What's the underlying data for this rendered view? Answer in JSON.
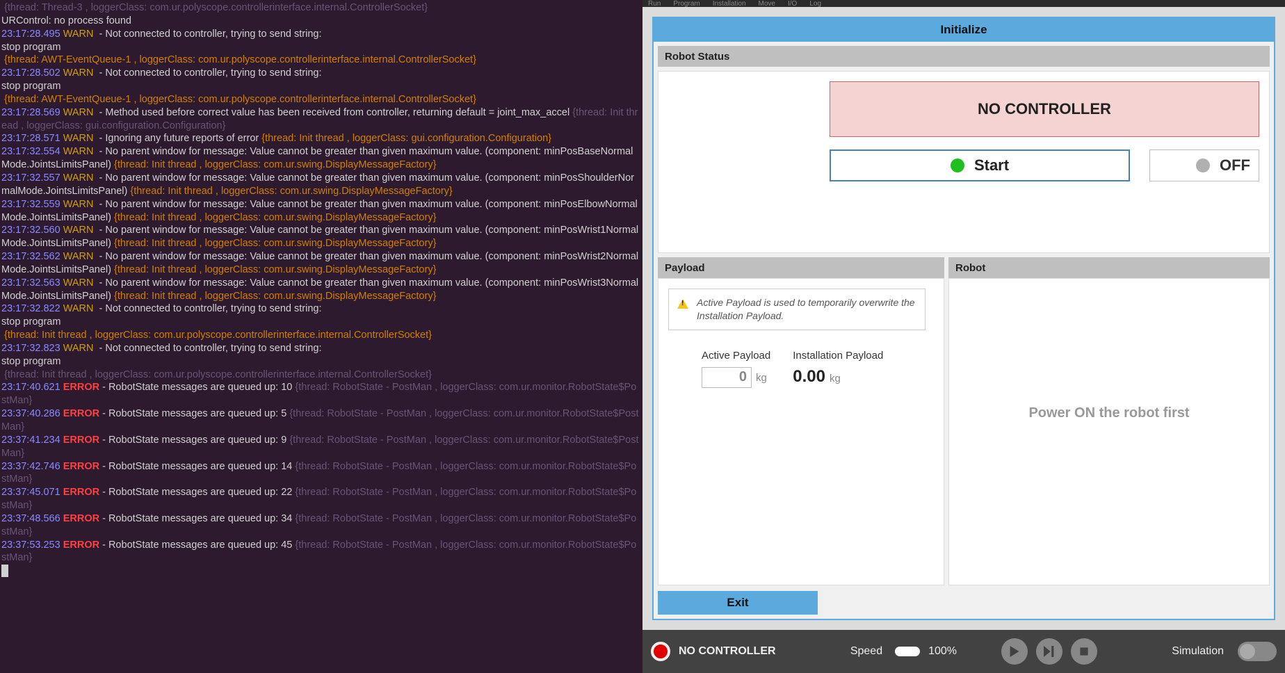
{
  "terminal": {
    "lines": [
      {
        "segments": [
          {
            "text": " {thread: Thread-3 , loggerClass: com.ur.polyscope.controllerinterface.internal.ControllerSocket}",
            "cls": "meta"
          }
        ]
      },
      {
        "segments": [
          {
            "text": "URControl: no process found",
            "cls": "msg"
          }
        ]
      },
      {
        "segments": [
          {
            "text": "23:17:28.495 ",
            "cls": "ts"
          },
          {
            "text": "WARN ",
            "cls": "warn"
          },
          {
            "text": " - Not connected to controller, trying to send string:",
            "cls": "msg"
          }
        ]
      },
      {
        "segments": [
          {
            "text": "stop program",
            "cls": "msg"
          }
        ]
      },
      {
        "segments": [
          {
            "text": " {thread: AWT-EventQueue-1 , loggerClass: com.ur.polyscope.controllerinterface.internal.ControllerSocket}",
            "cls": "ctx"
          }
        ]
      },
      {
        "segments": [
          {
            "text": "23:17:28.502 ",
            "cls": "ts"
          },
          {
            "text": "WARN ",
            "cls": "warn"
          },
          {
            "text": " - Not connected to controller, trying to send string:",
            "cls": "msg"
          }
        ]
      },
      {
        "segments": [
          {
            "text": "stop program",
            "cls": "msg"
          }
        ]
      },
      {
        "segments": [
          {
            "text": " {thread: AWT-EventQueue-1 , loggerClass: com.ur.polyscope.controllerinterface.internal.ControllerSocket}",
            "cls": "ctx"
          }
        ]
      },
      {
        "segments": [
          {
            "text": "23:17:28.569 ",
            "cls": "ts"
          },
          {
            "text": "WARN ",
            "cls": "warn"
          },
          {
            "text": " - Method used before correct value has been received from controller, returning default = joint_max_accel ",
            "cls": "msg"
          },
          {
            "text": "{thread: Init thread , loggerClass: gui.configuration.Configuration}",
            "cls": "meta"
          }
        ]
      },
      {
        "segments": [
          {
            "text": "23:17:28.571 ",
            "cls": "ts"
          },
          {
            "text": "WARN ",
            "cls": "warn"
          },
          {
            "text": " - Ignoring any future reports of error ",
            "cls": "msg"
          },
          {
            "text": "{thread: Init thread , loggerClass: gui.configuration.Configuration}",
            "cls": "ctx"
          }
        ]
      },
      {
        "segments": [
          {
            "text": "23:17:32.554 ",
            "cls": "ts"
          },
          {
            "text": "WARN ",
            "cls": "warn"
          },
          {
            "text": " - No parent window for message: Value cannot be greater than given maximum value. (component: minPosBaseNormalMode.JointsLimitsPanel) ",
            "cls": "msg"
          },
          {
            "text": "{thread: Init thread , loggerClass: com.ur.swing.DisplayMessageFactory}",
            "cls": "ctx"
          }
        ]
      },
      {
        "segments": [
          {
            "text": "23:17:32.557 ",
            "cls": "ts"
          },
          {
            "text": "WARN ",
            "cls": "warn"
          },
          {
            "text": " - No parent window for message: Value cannot be greater than given maximum value. (component: minPosShoulderNormalMode.JointsLimitsPanel) ",
            "cls": "msg"
          },
          {
            "text": "{thread: Init thread , loggerClass: com.ur.swing.DisplayMessageFactory}",
            "cls": "ctx"
          }
        ]
      },
      {
        "segments": [
          {
            "text": "23:17:32.559 ",
            "cls": "ts"
          },
          {
            "text": "WARN ",
            "cls": "warn"
          },
          {
            "text": " - No parent window for message: Value cannot be greater than given maximum value. (component: minPosElbowNormalMode.JointsLimitsPanel) ",
            "cls": "msg"
          },
          {
            "text": "{thread: Init thread , loggerClass: com.ur.swing.DisplayMessageFactory}",
            "cls": "ctx"
          }
        ]
      },
      {
        "segments": [
          {
            "text": "23:17:32.560 ",
            "cls": "ts"
          },
          {
            "text": "WARN ",
            "cls": "warn"
          },
          {
            "text": " - No parent window for message: Value cannot be greater than given maximum value. (component: minPosWrist1NormalMode.JointsLimitsPanel) ",
            "cls": "msg"
          },
          {
            "text": "{thread: Init thread , loggerClass: com.ur.swing.DisplayMessageFactory}",
            "cls": "ctx"
          }
        ]
      },
      {
        "segments": [
          {
            "text": "23:17:32.562 ",
            "cls": "ts"
          },
          {
            "text": "WARN ",
            "cls": "warn"
          },
          {
            "text": " - No parent window for message: Value cannot be greater than given maximum value. (component: minPosWrist2NormalMode.JointsLimitsPanel) ",
            "cls": "msg"
          },
          {
            "text": "{thread: Init thread , loggerClass: com.ur.swing.DisplayMessageFactory}",
            "cls": "ctx"
          }
        ]
      },
      {
        "segments": [
          {
            "text": "23:17:32.563 ",
            "cls": "ts"
          },
          {
            "text": "WARN ",
            "cls": "warn"
          },
          {
            "text": " - No parent window for message: Value cannot be greater than given maximum value. (component: minPosWrist3NormalMode.JointsLimitsPanel) ",
            "cls": "msg"
          },
          {
            "text": "{thread: Init thread , loggerClass: com.ur.swing.DisplayMessageFactory}",
            "cls": "ctx"
          }
        ]
      },
      {
        "segments": [
          {
            "text": "23:17:32.822 ",
            "cls": "ts"
          },
          {
            "text": "WARN ",
            "cls": "warn"
          },
          {
            "text": " - Not connected to controller, trying to send string:",
            "cls": "msg"
          }
        ]
      },
      {
        "segments": [
          {
            "text": "stop program",
            "cls": "msg"
          }
        ]
      },
      {
        "segments": [
          {
            "text": " {thread: Init thread , loggerClass: com.ur.polyscope.controllerinterface.internal.ControllerSocket}",
            "cls": "ctx"
          }
        ]
      },
      {
        "segments": [
          {
            "text": "23:17:32.823 ",
            "cls": "ts"
          },
          {
            "text": "WARN ",
            "cls": "warn"
          },
          {
            "text": " - Not connected to controller, trying to send string:",
            "cls": "msg"
          }
        ]
      },
      {
        "segments": [
          {
            "text": "stop program",
            "cls": "msg"
          }
        ]
      },
      {
        "segments": [
          {
            "text": " {thread: Init thread , loggerClass: com.ur.polyscope.controllerinterface.internal.ControllerSocket}",
            "cls": "meta"
          }
        ]
      },
      {
        "segments": [
          {
            "text": "23:17:40.621 ",
            "cls": "ts"
          },
          {
            "text": "ERROR",
            "cls": "err"
          },
          {
            "text": " - RobotState messages are queued up: 10 ",
            "cls": "msg"
          },
          {
            "text": "{thread: RobotState - PostMan , loggerClass: com.ur.monitor.RobotState$PostMan}",
            "cls": "meta"
          }
        ]
      },
      {
        "segments": [
          {
            "text": "23:37:40.286 ",
            "cls": "ts"
          },
          {
            "text": "ERROR",
            "cls": "err"
          },
          {
            "text": " - RobotState messages are queued up: 5 ",
            "cls": "msg"
          },
          {
            "text": "{thread: RobotState - PostMan , loggerClass: com.ur.monitor.RobotState$PostMan}",
            "cls": "meta"
          }
        ]
      },
      {
        "segments": [
          {
            "text": "23:37:41.234 ",
            "cls": "ts"
          },
          {
            "text": "ERROR",
            "cls": "err"
          },
          {
            "text": " - RobotState messages are queued up: 9 ",
            "cls": "msg"
          },
          {
            "text": "{thread: RobotState - PostMan , loggerClass: com.ur.monitor.RobotState$PostMan}",
            "cls": "meta"
          }
        ]
      },
      {
        "segments": [
          {
            "text": "23:37:42.746 ",
            "cls": "ts"
          },
          {
            "text": "ERROR",
            "cls": "err"
          },
          {
            "text": " - RobotState messages are queued up: 14 ",
            "cls": "msg"
          },
          {
            "text": "{thread: RobotState - PostMan , loggerClass: com.ur.monitor.RobotState$PostMan}",
            "cls": "meta"
          }
        ]
      },
      {
        "segments": [
          {
            "text": "23:37:45.071 ",
            "cls": "ts"
          },
          {
            "text": "ERROR",
            "cls": "err"
          },
          {
            "text": " - RobotState messages are queued up: 22 ",
            "cls": "msg"
          },
          {
            "text": "{thread: RobotState - PostMan , loggerClass: com.ur.monitor.RobotState$PostMan}",
            "cls": "meta"
          }
        ]
      },
      {
        "segments": [
          {
            "text": "23:37:48.566 ",
            "cls": "ts"
          },
          {
            "text": "ERROR",
            "cls": "err"
          },
          {
            "text": " - RobotState messages are queued up: 34 ",
            "cls": "msg"
          },
          {
            "text": "{thread: RobotState - PostMan , loggerClass: com.ur.monitor.RobotState$PostMan}",
            "cls": "meta"
          }
        ]
      },
      {
        "segments": [
          {
            "text": "23:37:53.253 ",
            "cls": "ts"
          },
          {
            "text": "ERROR",
            "cls": "err"
          },
          {
            "text": " - RobotState messages are queued up: 45 ",
            "cls": "msg"
          },
          {
            "text": "{thread: RobotState - PostMan , loggerClass: com.ur.monitor.RobotState$PostMan}",
            "cls": "meta"
          }
        ]
      }
    ]
  },
  "menu": {
    "items": [
      "Run",
      "Program",
      "Installation",
      "Move",
      "I/O",
      "Log"
    ]
  },
  "panel": {
    "title": "Initialize",
    "robot_status_header": "Robot Status",
    "nc_banner": "NO CONTROLLER",
    "start_label": "Start",
    "off_label": "OFF",
    "payload_header": "Payload",
    "robot_header": "Robot",
    "hint_text": "Active Payload is used to temporarily overwrite the Installation Payload.",
    "active_payload_label": "Active Payload",
    "installation_payload_label": "Installation Payload",
    "active_payload_value": "0",
    "installation_payload_value": "0.00",
    "unit_kg": "kg",
    "robot_msg": "Power ON the robot first",
    "exit_label": "Exit"
  },
  "bottombar": {
    "status": "NO CONTROLLER",
    "speed_label": "Speed",
    "speed_value": "100%",
    "simulation_label": "Simulation"
  }
}
